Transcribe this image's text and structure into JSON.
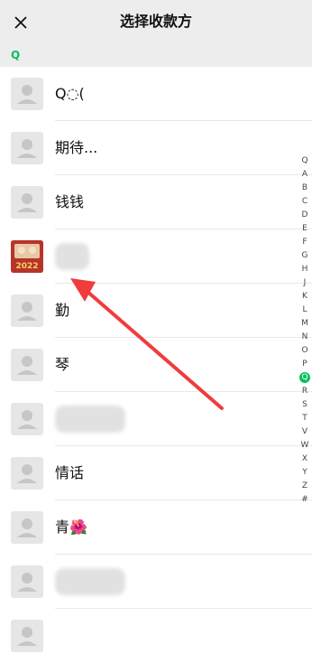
{
  "header": {
    "title": "选择收款方"
  },
  "section": {
    "letter": "Q"
  },
  "contacts": [
    {
      "name": "Q◌("
    },
    {
      "name": "期待..."
    },
    {
      "name": "钱钱"
    },
    {
      "name": ""
    },
    {
      "name": "勤"
    },
    {
      "name": "琴"
    },
    {
      "name": ""
    },
    {
      "name": "情话"
    },
    {
      "name": "青🌺"
    },
    {
      "name": ""
    }
  ],
  "avatar_badge": "2022",
  "index_letters": [
    "Q",
    "A",
    "B",
    "C",
    "D",
    "E",
    "F",
    "G",
    "H",
    "J",
    "K",
    "L",
    "M",
    "N",
    "O",
    "P",
    "Q",
    "R",
    "S",
    "T",
    "V",
    "W",
    "X",
    "Y",
    "Z",
    "#"
  ],
  "index_active": "Q",
  "colors": {
    "accent": "#07c160",
    "arrow": "#f03c3c"
  }
}
